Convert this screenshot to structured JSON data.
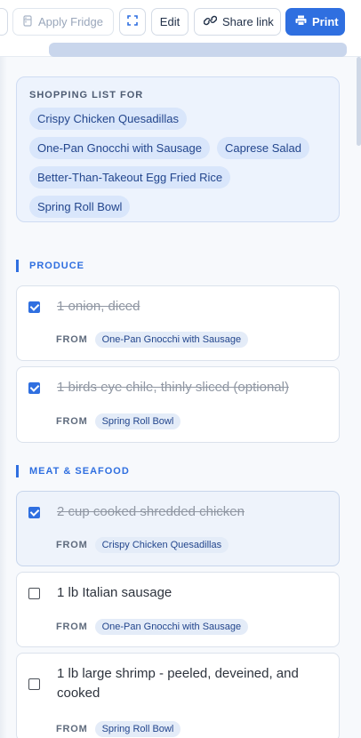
{
  "toolbar": {
    "apply_fridge_label": "Apply Fridge",
    "edit_label": "Edit",
    "share_label": "Share link",
    "print_label": "Print"
  },
  "shopping_list": {
    "title": "SHOPPING LIST FOR",
    "recipes": [
      "Crispy Chicken Quesadillas",
      "One-Pan Gnocchi with Sausage",
      "Caprese Salad",
      "Better-Than-Takeout Egg Fried Rice",
      "Spring Roll Bowl"
    ]
  },
  "sections": [
    {
      "title": "PRODUCE",
      "items": [
        {
          "text": "1 onion, diced",
          "checked": true,
          "from_label": "FROM",
          "from": "One-Pan Gnocchi with Sausage"
        },
        {
          "text": "1 birds eye chile, thinly sliced (optional)",
          "checked": true,
          "from_label": "FROM",
          "from": "Spring Roll Bowl"
        }
      ]
    },
    {
      "title": "MEAT & SEAFOOD",
      "items": [
        {
          "text": "2 cup cooked shredded chicken",
          "checked": true,
          "from_label": "FROM",
          "from": "Crispy Chicken Quesadillas"
        },
        {
          "text": "1 lb Italian sausage",
          "checked": false,
          "from_label": "FROM",
          "from": "One-Pan Gnocchi with Sausage"
        },
        {
          "text": "1 lb large shrimp - peeled, deveined, and cooked",
          "checked": false,
          "from_label": "FROM",
          "from": "Spring Roll Bowl"
        }
      ]
    }
  ],
  "icons": {
    "fridge": "fridge-icon",
    "expand": "expand-icon",
    "share": "link-icon",
    "print": "printer-icon"
  },
  "colors": {
    "accent": "#2f6fe0",
    "chip_bg": "#d9e6fb",
    "chip_text": "#23468d"
  }
}
